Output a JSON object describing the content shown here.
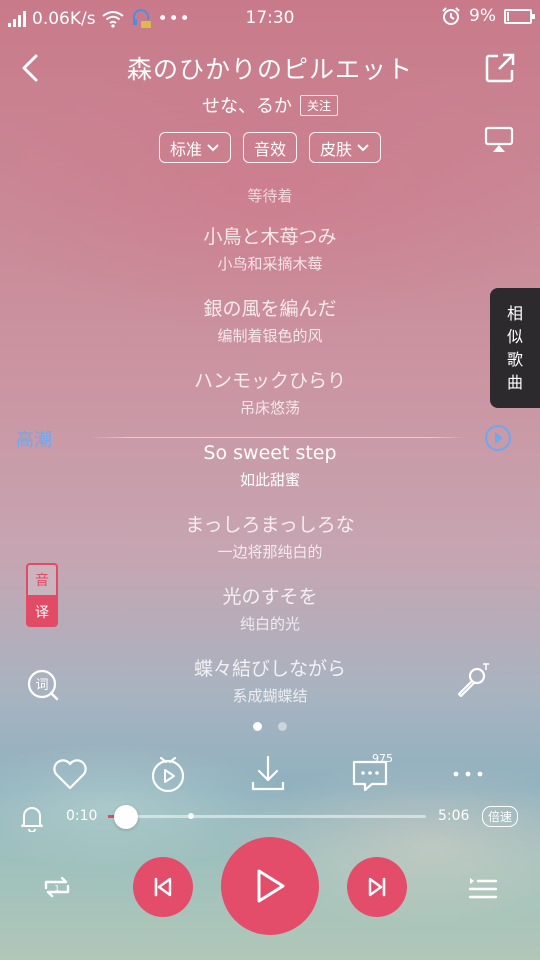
{
  "status_bar": {
    "speed": "0.06K/s",
    "time": "17:30",
    "battery": "9%",
    "battery_level": 0.09
  },
  "song": {
    "title": "森のひかりのピルエット",
    "artist": "せな、るか",
    "follow_label": "关注"
  },
  "options": {
    "quality": "标准",
    "effects": "音效",
    "skin": "皮肤"
  },
  "lyrics": {
    "waiting": "等待着",
    "lines": [
      {
        "jp": "小鳥と木苺つみ",
        "cn": "小鸟和采摘木莓"
      },
      {
        "jp": "銀の風を編んだ",
        "cn": "编制着银色的风"
      },
      {
        "jp": "ハンモックひらり",
        "cn": "吊床悠荡"
      },
      {
        "jp": "So sweet step",
        "cn": "如此甜蜜"
      },
      {
        "jp": "まっしろまっしろな",
        "cn": "一边将那纯白的"
      },
      {
        "jp": "光のすそを",
        "cn": "纯白的光"
      },
      {
        "jp": "蝶々結びしながら",
        "cn": "系成蝴蝶结"
      }
    ]
  },
  "climax_label": "高潮",
  "similar_songs": [
    "相",
    "似",
    "歌",
    "曲"
  ],
  "translate_toggle": {
    "original": "音",
    "translated": "译"
  },
  "actions": {
    "comment_count": "975"
  },
  "progress": {
    "current": "0:10",
    "total": "5:06",
    "played_fraction": 0.033,
    "buffered_fraction": 0.25,
    "speed_label": "倍速"
  },
  "icons": {
    "back": "back-arrow-icon",
    "share": "share-icon",
    "cast": "cast-icon",
    "like": "heart-icon",
    "video": "video-icon",
    "download": "download-icon",
    "comment": "comment-icon",
    "more": "more-icon",
    "alarm": "bell-icon",
    "repeat": "repeat-icon",
    "prev": "previous-icon",
    "play": "play-icon",
    "next": "next-icon",
    "playlist": "playlist-icon"
  },
  "colors": {
    "accent": "#e34d6a",
    "climax": "#6ea8ee"
  }
}
